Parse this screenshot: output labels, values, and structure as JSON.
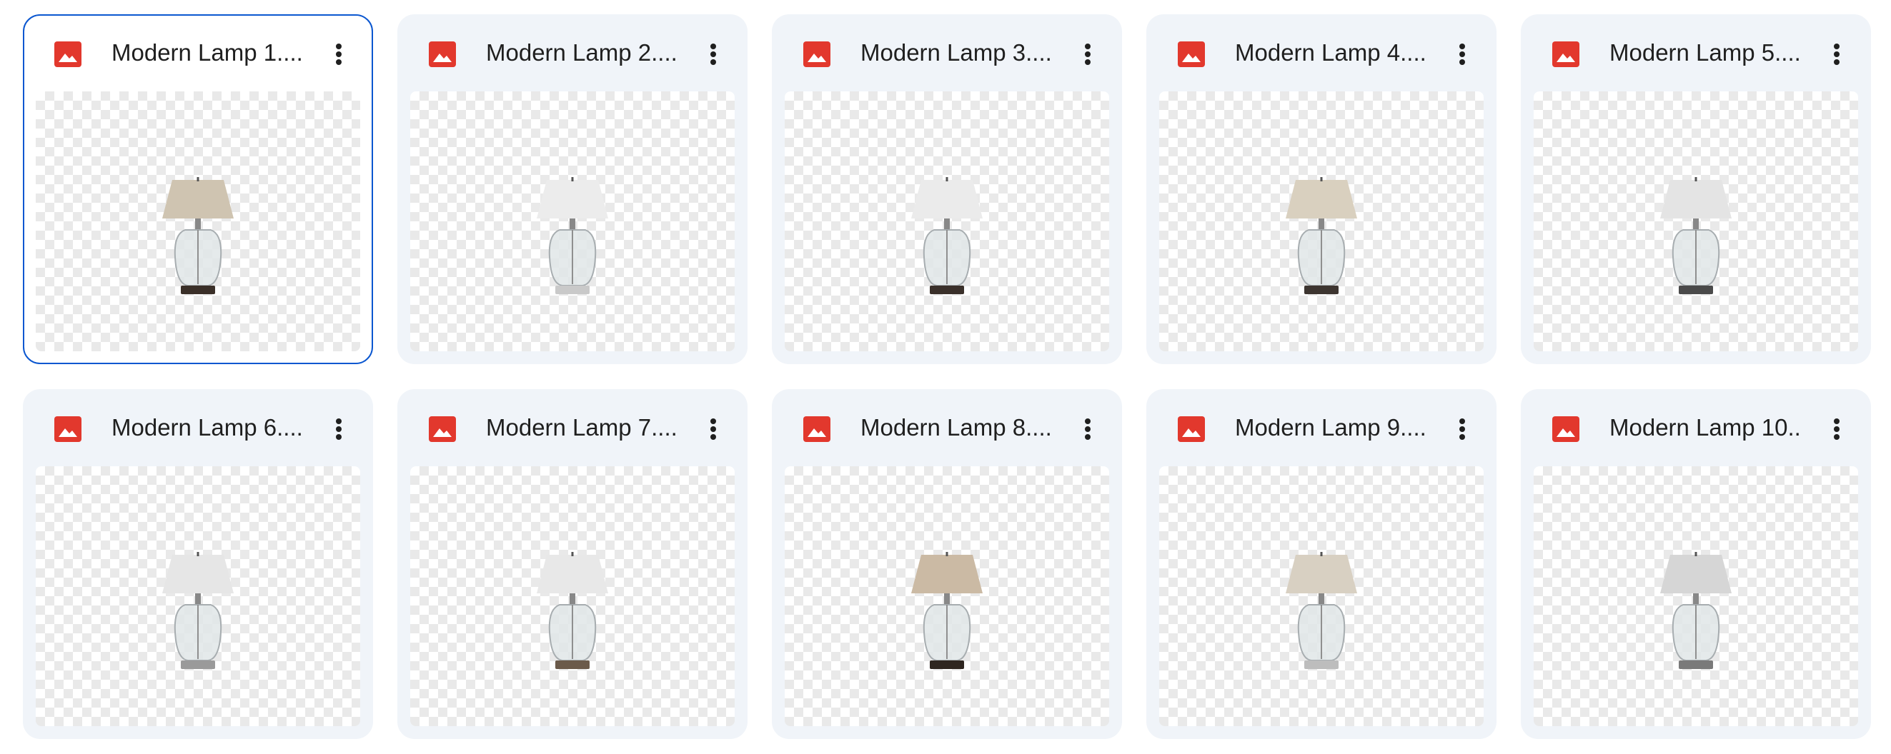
{
  "files": [
    {
      "title": "Modern Lamp 1....",
      "selected": true,
      "lamp": {
        "shade": "#cfc4b1",
        "base": "#3a2f28"
      }
    },
    {
      "title": "Modern Lamp 2....",
      "selected": false,
      "lamp": {
        "shade": "#ececec",
        "base": "#c9c9c9"
      }
    },
    {
      "title": "Modern Lamp 3....",
      "selected": false,
      "lamp": {
        "shade": "#ebebeb",
        "base": "#3a302a"
      }
    },
    {
      "title": "Modern Lamp 4....",
      "selected": false,
      "lamp": {
        "shade": "#d9d0bf",
        "base": "#3d3530"
      }
    },
    {
      "title": "Modern Lamp 5....",
      "selected": false,
      "lamp": {
        "shade": "#e4e4e4",
        "base": "#4a4a4a"
      }
    },
    {
      "title": "Modern Lamp 6....",
      "selected": false,
      "lamp": {
        "shade": "#e6e6e6",
        "base": "#9a9a9a"
      }
    },
    {
      "title": "Modern Lamp 7....",
      "selected": false,
      "lamp": {
        "shade": "#e8e8e8",
        "base": "#6b5a4a"
      }
    },
    {
      "title": "Modern Lamp 8....",
      "selected": false,
      "lamp": {
        "shade": "#cbbaa4",
        "base": "#2f2620"
      }
    },
    {
      "title": "Modern Lamp 9....",
      "selected": false,
      "lamp": {
        "shade": "#d8d0c2",
        "base": "#bdbdbd"
      }
    },
    {
      "title": "Modern Lamp 10...",
      "selected": false,
      "lamp": {
        "shade": "#d6d6d6",
        "base": "#7a7a7a"
      }
    }
  ],
  "icons": {
    "file_type": "image-file-icon",
    "more": "more-vert-icon"
  },
  "colors": {
    "file_icon": "#e2382d",
    "selection_border": "#0b57d0",
    "card_bg": "#f0f4f9",
    "more_icon": "#1f1f1f"
  }
}
